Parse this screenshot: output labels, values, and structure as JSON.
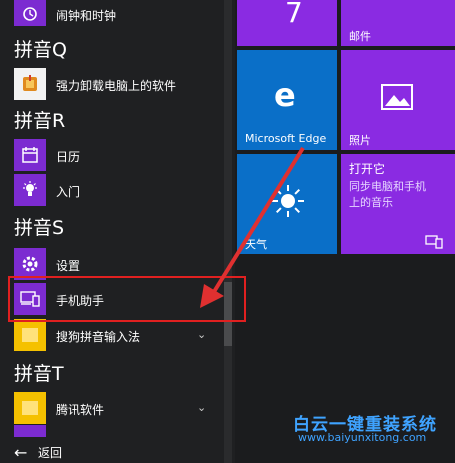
{
  "left_list": {
    "items": [
      {
        "label": "闹钟和时钟",
        "icon": "alarm-clock-icon"
      },
      {
        "label": "强力卸载电脑上的软件",
        "icon": "uninstaller-icon"
      },
      {
        "label": "日历",
        "icon": "calendar-icon"
      },
      {
        "label": "入门",
        "icon": "lightbulb-icon"
      },
      {
        "label": "设置",
        "icon": "gear-icon"
      },
      {
        "label": "手机助手",
        "icon": "phone-assistant-icon"
      },
      {
        "label": "搜狗拼音输入法",
        "icon": "folder-icon"
      },
      {
        "label": "腾讯软件",
        "icon": "folder-icon"
      }
    ],
    "headers": [
      "拼音Q",
      "拼音R",
      "拼音S",
      "拼音T"
    ],
    "back_label": "返回"
  },
  "tiles": {
    "mail": "邮件",
    "edge": "Microsoft Edge",
    "photos": "照片",
    "weather": "天气",
    "tile_top_number": "7",
    "dakaita": {
      "title": "打开它",
      "line1": "同步电脑和手机",
      "line2": "上的音乐"
    }
  },
  "watermark": {
    "title": "白云一键重装系统",
    "url": "www.baiyunxitong.com"
  },
  "colors": {
    "tile": "#8a2be2",
    "tile_blue": "#0a6fc8",
    "highlight": "#e02020",
    "arrow": "#e03030"
  }
}
